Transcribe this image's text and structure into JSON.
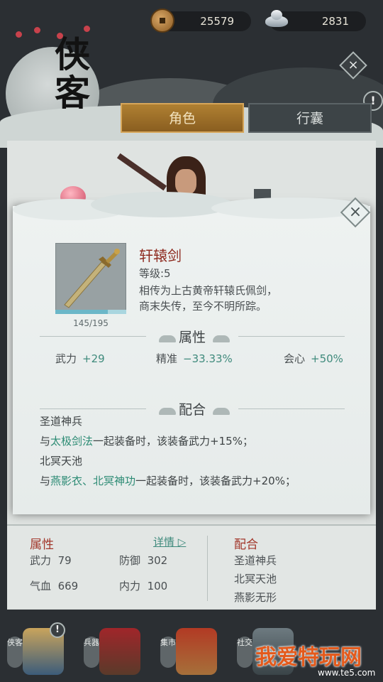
{
  "currency": {
    "coins": "25579",
    "silver": "2831"
  },
  "header": {
    "title_line1": "侠",
    "title_line2": "客"
  },
  "tabs": [
    {
      "label": "角色",
      "active": true
    },
    {
      "label": "行囊",
      "active": false
    }
  ],
  "popup": {
    "item_name": "轩辕剑",
    "level_text": "等级:5",
    "description_line1": "相传为上古黄帝轩辕氏佩剑，",
    "description_line2": "商末失传，至今不明所踪。",
    "progress_text": "145/195",
    "progress_fraction": 0.744,
    "attributes_title": "属性",
    "attributes": [
      {
        "label": "武力",
        "value": "+29"
      },
      {
        "label": "精准",
        "value": "−33.33%"
      },
      {
        "label": "会心",
        "value": "+50%"
      }
    ],
    "combo_title": "配合",
    "combos": [
      {
        "set_name": "圣道神兵",
        "prefix": "与",
        "skills": "太极剑法",
        "suffix": "一起装备时，该装备武力+15%；"
      },
      {
        "set_name": "北冥天池",
        "prefix": "与",
        "skills": "燕影衣、北冥神功",
        "suffix": "一起装备时，该装备武力+20%；"
      }
    ]
  },
  "stats": {
    "attr_title": "属性",
    "details_link": "详情",
    "rows": [
      {
        "label": "武力",
        "value": "79"
      },
      {
        "label": "防御",
        "value": "302"
      },
      {
        "label": "气血",
        "value": "669"
      },
      {
        "label": "内力",
        "value": "100"
      }
    ],
    "combo_title": "配合",
    "combo_list": [
      "圣道神兵",
      "北冥天池",
      "燕影无形"
    ]
  },
  "bottom_nav": [
    {
      "label": "侠客"
    },
    {
      "label": "兵器"
    },
    {
      "label": "集市"
    },
    {
      "label": "社交"
    }
  ],
  "watermark": {
    "text": "我爱特玩网",
    "sub": "www.te5.com"
  },
  "colors": {
    "accent_gold": "#b08032",
    "item_name_red": "#8e2b20",
    "positive_teal": "#3f8a7c",
    "highlight_green": "#2c8b74"
  }
}
